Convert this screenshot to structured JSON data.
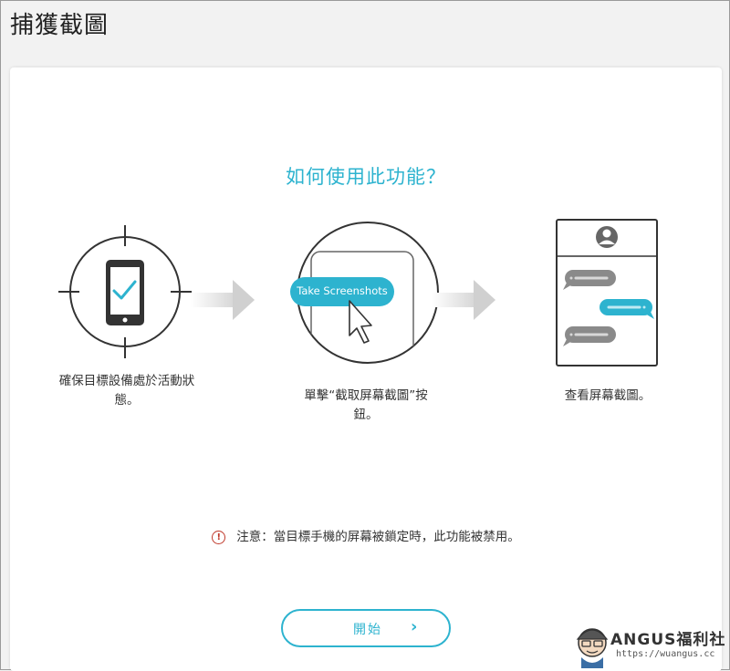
{
  "window": {
    "title": "捕獲截圖"
  },
  "main": {
    "heading": "如何使用此功能？",
    "steps": [
      {
        "caption_line1": "確保目標設備處於活動狀",
        "caption_line2": "態。"
      },
      {
        "button_text": "Take Screenshots",
        "caption_line1": "單擊“截取屏幕截圖”按",
        "caption_line2": "鈕。"
      },
      {
        "caption_line1": "查看屏幕截圖。"
      }
    ],
    "note": {
      "icon": "info-icon",
      "text": "注意：當目標手機的屏幕被鎖定時，此功能被禁用。"
    },
    "start_button": {
      "label": "開始",
      "icon": "chevron-right-icon"
    }
  },
  "watermark": {
    "text": "ANGUS福利社",
    "url": "https://wuangus.cc"
  },
  "colors": {
    "accent": "#2db3cf",
    "warning": "#c0392b",
    "icon_dark": "#333333"
  }
}
